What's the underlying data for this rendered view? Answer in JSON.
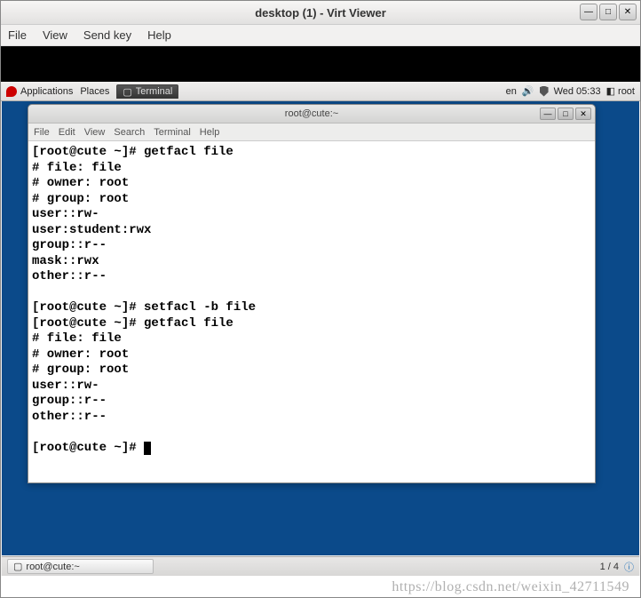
{
  "virt": {
    "title": "desktop (1) - Virt Viewer",
    "menu": {
      "file": "File",
      "view": "View",
      "sendkey": "Send key",
      "help": "Help"
    },
    "wc": {
      "min": "—",
      "max": "□",
      "close": "✕"
    }
  },
  "gnome_panel": {
    "applications": "Applications",
    "places": "Places",
    "terminal_label": "Terminal",
    "lang": "en",
    "clock": "Wed 05:33",
    "user": "root"
  },
  "terminal": {
    "title": "root@cute:~",
    "menu": {
      "file": "File",
      "edit": "Edit",
      "view": "View",
      "search": "Search",
      "terminal": "Terminal",
      "help": "Help"
    },
    "lines": [
      "[root@cute ~]# getfacl file",
      "# file: file",
      "# owner: root",
      "# group: root",
      "user::rw-",
      "user:student:rwx",
      "group::r--",
      "mask::rwx",
      "other::r--",
      "",
      "[root@cute ~]# setfacl -b file",
      "[root@cute ~]# getfacl file",
      "# file: file",
      "# owner: root",
      "# group: root",
      "user::rw-",
      "group::r--",
      "other::r--",
      "",
      "[root@cute ~]# "
    ]
  },
  "taskbar": {
    "task1": "root@cute:~",
    "pager": "1 / 4"
  },
  "watermark": "https://blog.csdn.net/weixin_42711549"
}
